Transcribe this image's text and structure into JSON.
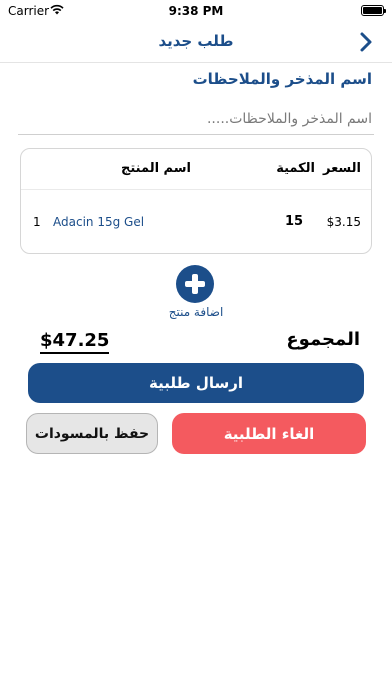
{
  "status_bar": {
    "carrier": "Carrier",
    "time": "9:38 PM"
  },
  "nav": {
    "title": "طلب جديد"
  },
  "notes": {
    "heading": "اسم المذخر والملاحظات",
    "placeholder": "اسم المذخر والملاحظات....."
  },
  "table": {
    "headers": {
      "price": "السعر",
      "qty": "الكمية",
      "name": "اسم المنتج"
    },
    "rows": [
      {
        "index": "1",
        "name": "Adacin 15g Gel",
        "qty": "15",
        "price": "$3.15"
      }
    ]
  },
  "add_product": {
    "label": "اضافة منتج"
  },
  "total": {
    "label": "المجموع",
    "amount": "$47.25"
  },
  "buttons": {
    "send": "ارسال طلبية",
    "cancel": "الغاء الطلبية",
    "save_draft": "حفظ بالمسودات"
  },
  "colors": {
    "primary": "#1c4e8a",
    "danger": "#f45a5f",
    "neutral": "#e6e6e6"
  }
}
